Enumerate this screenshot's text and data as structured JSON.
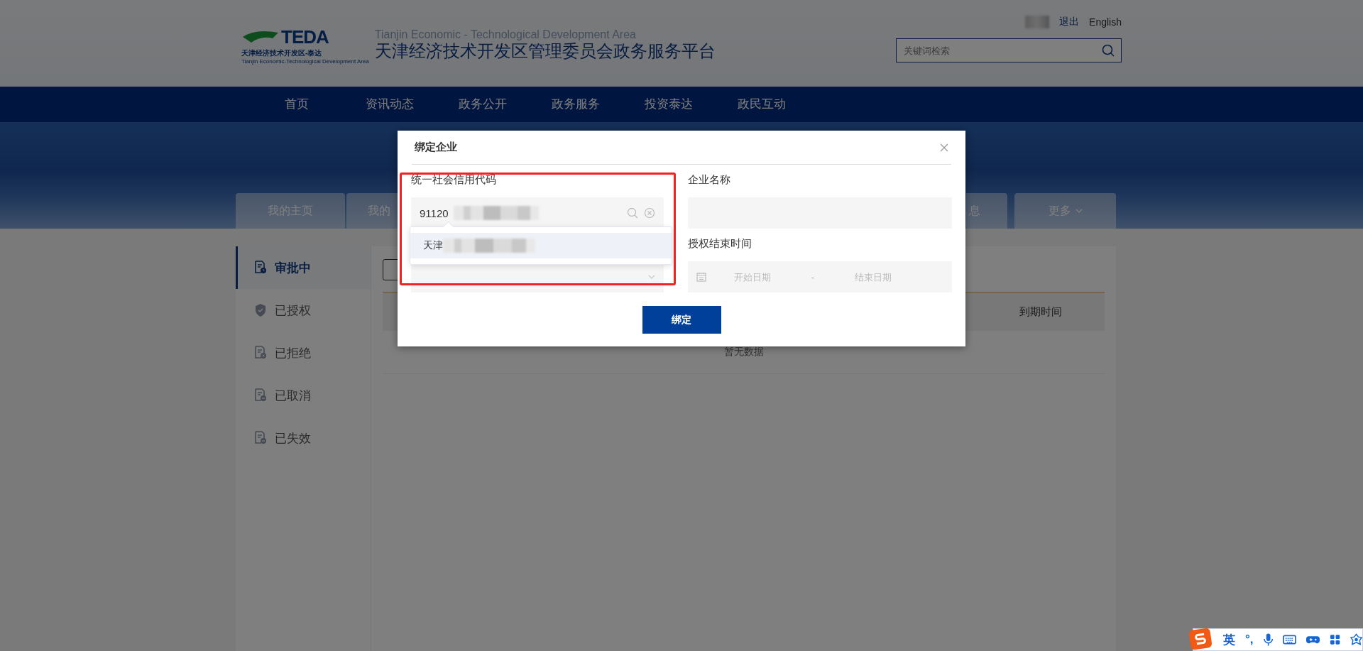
{
  "header": {
    "logo": {
      "mark": "TEDA",
      "subtitle_cn": "天津经济技术开发区-泰达",
      "subtitle_en": "Tianjin Economic-Technological Development Area"
    },
    "site_subtitle": "Tianjin Economic - Technological Development Area",
    "site_title": "天津经济技术开发区管理委员会政务服务平台",
    "logout": "退出",
    "language": "English",
    "search": {
      "placeholder": "关键词检索"
    }
  },
  "nav": {
    "items": [
      {
        "label": "首页"
      },
      {
        "label": "资讯动态"
      },
      {
        "label": "政务公开"
      },
      {
        "label": "政务服务"
      },
      {
        "label": "投资泰达"
      },
      {
        "label": "政民互动"
      }
    ]
  },
  "tabs": [
    {
      "label": "我的主页",
      "kind": "plain"
    },
    {
      "label": "我的",
      "kind": "plain"
    },
    {
      "label": "息",
      "kind": "plain"
    },
    {
      "label": "更多",
      "kind": "menu"
    }
  ],
  "sidebar": {
    "items": [
      {
        "label": "审批中",
        "kind": "pending",
        "selected": true
      },
      {
        "label": "已授权",
        "kind": "authorized",
        "selected": false
      },
      {
        "label": "已拒绝",
        "kind": "rejected",
        "selected": false
      },
      {
        "label": "已取消",
        "kind": "cancelled",
        "selected": false
      },
      {
        "label": "已失效",
        "kind": "expired",
        "selected": false
      }
    ]
  },
  "table": {
    "columns": [
      {
        "label": "到期时间"
      }
    ],
    "empty_text": "暂无数据"
  },
  "dialog": {
    "title": "绑定企业",
    "credit_code": {
      "label": "统一社会信用代码",
      "value": "91120"
    },
    "company_name": {
      "label": "企业名称"
    },
    "suggestions": [
      {
        "text": "天津",
        "selected": true
      }
    ],
    "end_time": {
      "label": "授权结束时间",
      "start_placeholder": "开始日期",
      "separator": "-",
      "end_placeholder": "结束日期"
    },
    "submit": "绑定"
  },
  "ime_bar": {
    "mode": "英",
    "punctuation": "°,"
  }
}
